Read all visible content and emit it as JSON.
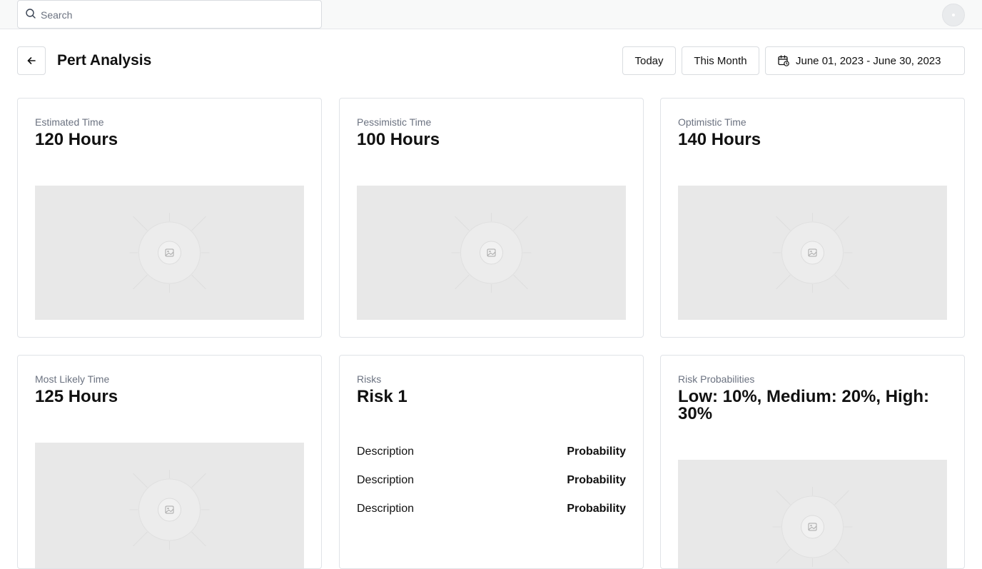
{
  "search": {
    "placeholder": "Search",
    "value": ""
  },
  "header": {
    "title": "Pert Analysis",
    "buttons": {
      "today": "Today",
      "this_month": "This Month",
      "date_range": "June 01, 2023 - June 30, 2023"
    }
  },
  "cards": [
    {
      "label": "Estimated Time",
      "value": "120 Hours"
    },
    {
      "label": "Pessimistic Time",
      "value": "100 Hours"
    },
    {
      "label": "Optimistic Time",
      "value": "140 Hours"
    },
    {
      "label": "Most Likely Time",
      "value": "125 Hours"
    },
    {
      "label": "Risks",
      "value": "Risk 1",
      "rows": [
        {
          "description": "Description",
          "probability": "Probability"
        },
        {
          "description": "Description",
          "probability": "Probability"
        },
        {
          "description": "Description",
          "probability": "Probability"
        }
      ]
    },
    {
      "label": "Risk Probabilities",
      "value": "Low: 10%, Medium: 20%, High: 30%"
    }
  ],
  "icons": {
    "search": "search-icon",
    "back": "arrow-left-icon",
    "calendar": "calendar-icon",
    "image_placeholder": "image-placeholder-icon"
  },
  "colors": {
    "border": "#e0e3e7",
    "placeholder_bg": "#e8e8e8",
    "label": "#6b7280",
    "text": "#111111"
  }
}
